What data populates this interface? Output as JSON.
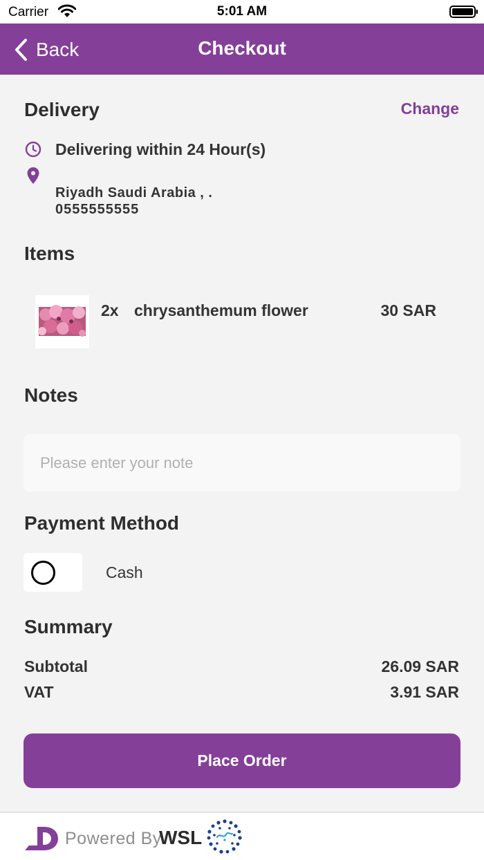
{
  "status_bar": {
    "carrier": "Carrier",
    "time": "5:01 AM"
  },
  "nav": {
    "back_label": "Back",
    "title": "Checkout"
  },
  "delivery": {
    "title": "Delivery",
    "change_label": "Change",
    "time_text": "Delivering within 24 Hour(s)",
    "address": "Riyadh Saudi Arabia ,  .",
    "phone": "0555555555"
  },
  "items": {
    "title": "Items",
    "list": [
      {
        "qty": "2x",
        "name": "chrysanthemum flower",
        "price": "30 SAR"
      }
    ]
  },
  "notes": {
    "title": "Notes",
    "placeholder": "Please enter your note"
  },
  "payment": {
    "title": "Payment Method",
    "option_label": "Cash"
  },
  "summary": {
    "title": "Summary",
    "subtotal_label": "Subtotal",
    "subtotal_value": "26.09 SAR",
    "vat_label": "VAT",
    "vat_value": "3.91 SAR"
  },
  "place_order_label": "Place Order",
  "footer": {
    "powered_label": "Powered By",
    "brand": "WSL"
  },
  "colors": {
    "primary": "#843f99",
    "background": "#f3f3f3"
  },
  "icons": [
    "wifi-icon",
    "battery-icon",
    "back-chevron-icon",
    "clock-icon",
    "location-pin-icon",
    "radio-icon",
    "powered-logo-icon",
    "wsl-seal-icon"
  ]
}
